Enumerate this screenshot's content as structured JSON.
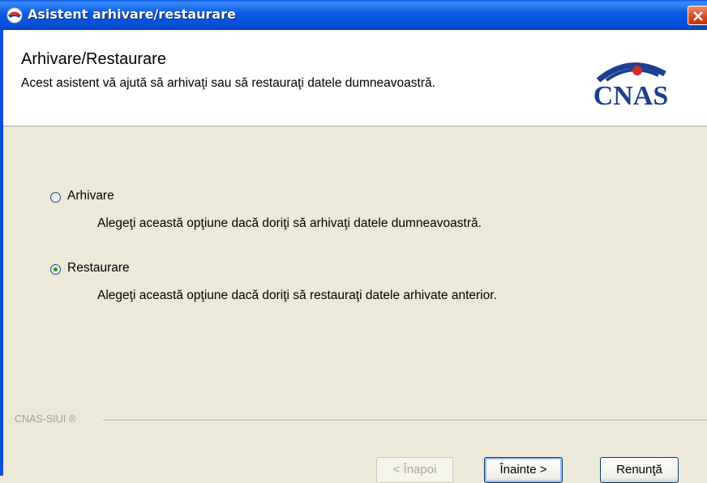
{
  "window": {
    "title": "Asistent arhivare/restaurare",
    "title_bar_color": "#0a5ae8",
    "close_icon": "close-icon"
  },
  "header": {
    "title": "Arhivare/Restaurare",
    "subtitle": "Acest asistent vă ajută să arhivaţi sau să restauraţi datele dumneavoastră.",
    "logo_text": "CNAS",
    "logo_color": "#1a3f8f",
    "logo_accent": "#d42a2a"
  },
  "options": [
    {
      "label": "Arhivare",
      "description": "Alegeţi această opţiune dacă doriţi să arhivaţi datele dumneavoastră.",
      "selected": false
    },
    {
      "label": "Restaurare",
      "description": "Alegeţi această opţiune dacă doriţi să restauraţi datele arhivate anterior.",
      "selected": true
    }
  ],
  "footer": {
    "brand": "CNAS-SIUI ®"
  },
  "buttons": {
    "back": "< Înapoi",
    "next": "Înainte >",
    "cancel": "Renunţă"
  }
}
